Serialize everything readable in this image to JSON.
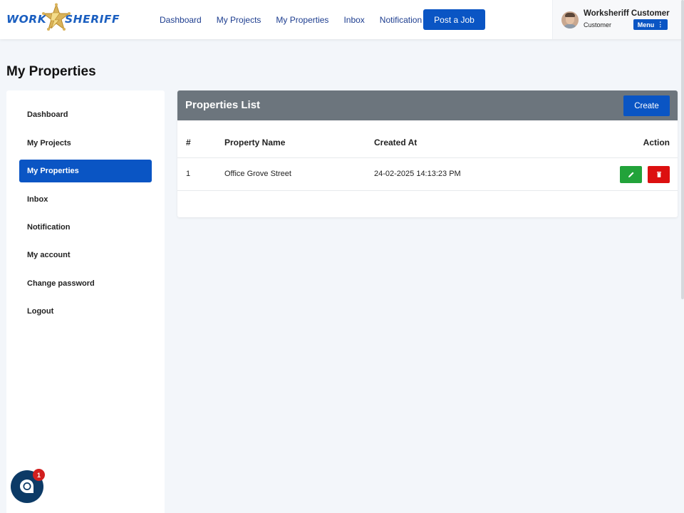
{
  "header": {
    "logo_left": "WORK",
    "logo_right": "SHERIFF",
    "nav": [
      "Dashboard",
      "My Projects",
      "My Properties",
      "Inbox",
      "Notification"
    ],
    "post_job_label": "Post a Job",
    "user": {
      "name": "Worksheriff Customer",
      "role": "Customer",
      "menu_label": "Menu"
    }
  },
  "page_title": "My Properties",
  "sidebar": {
    "items": [
      {
        "label": "Dashboard",
        "active": false
      },
      {
        "label": "My Projects",
        "active": false
      },
      {
        "label": "My Properties",
        "active": true
      },
      {
        "label": "Inbox",
        "active": false
      },
      {
        "label": "Notification",
        "active": false
      },
      {
        "label": "My account",
        "active": false
      },
      {
        "label": "Change password",
        "active": false
      },
      {
        "label": "Logout",
        "active": false
      }
    ]
  },
  "properties": {
    "title": "Properties List",
    "create_label": "Create",
    "columns": [
      "#",
      "Property Name",
      "Created At",
      "Action"
    ],
    "rows": [
      {
        "index": "1",
        "name": "Office Grove Street",
        "created_at": "24-02-2025 14:13:23 PM"
      }
    ]
  },
  "chat": {
    "badge_count": "1"
  },
  "colors": {
    "primary": "#0a55c4",
    "header_grey": "#6c757d",
    "edit_green": "#22a33a",
    "delete_red": "#dc1010",
    "chat_navy": "#0c3a66"
  },
  "icons": [
    "sheriff-star-icon",
    "menu-dots-icon",
    "pencil-icon",
    "trash-icon",
    "chat-icon"
  ]
}
